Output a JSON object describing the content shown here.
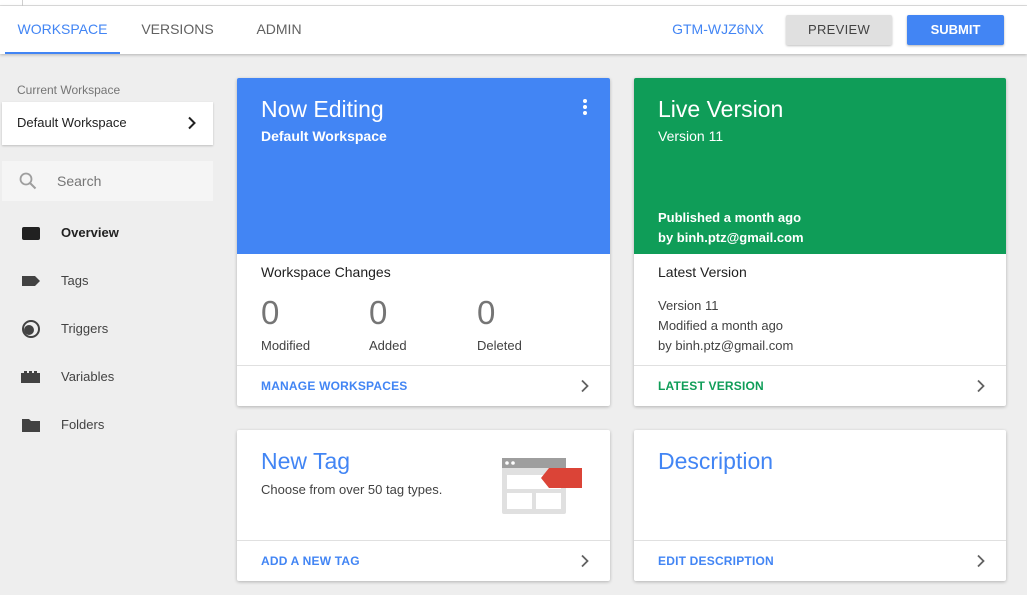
{
  "header": {
    "tabs": [
      {
        "label": "WORKSPACE",
        "active": true
      },
      {
        "label": "VERSIONS",
        "active": false
      },
      {
        "label": "ADMIN",
        "active": false
      }
    ],
    "container_id": "GTM-WJZ6NX",
    "preview_label": "PREVIEW",
    "submit_label": "SUBMIT"
  },
  "sidebar": {
    "current_workspace_label": "Current Workspace",
    "workspace_name": "Default Workspace",
    "search_placeholder": "Search",
    "items": [
      {
        "label": "Overview",
        "icon": "overview-icon",
        "active": true
      },
      {
        "label": "Tags",
        "icon": "tag-icon",
        "active": false
      },
      {
        "label": "Triggers",
        "icon": "trigger-icon",
        "active": false
      },
      {
        "label": "Variables",
        "icon": "variables-icon",
        "active": false
      },
      {
        "label": "Folders",
        "icon": "folder-icon",
        "active": false
      }
    ]
  },
  "editing_card": {
    "title": "Now Editing",
    "subtitle": "Default Workspace",
    "changes_title": "Workspace Changes",
    "stats": [
      {
        "value": "0",
        "label": "Modified"
      },
      {
        "value": "0",
        "label": "Added"
      },
      {
        "value": "0",
        "label": "Deleted"
      }
    ],
    "footer_link": "MANAGE WORKSPACES"
  },
  "live_card": {
    "title": "Live Version",
    "subtitle": "Version 11",
    "published_line1": "Published a month ago",
    "published_line2": "by binh.ptz@gmail.com",
    "latest_title": "Latest Version",
    "latest_lines": [
      "Version 11",
      "Modified a month ago",
      "by binh.ptz@gmail.com"
    ],
    "footer_link": "LATEST VERSION"
  },
  "newtag_card": {
    "title": "New Tag",
    "subtitle": "Choose from over 50 tag types.",
    "footer_link": "ADD A NEW TAG"
  },
  "description_card": {
    "title": "Description",
    "footer_link": "EDIT DESCRIPTION"
  },
  "colors": {
    "accent_blue": "#4285f4",
    "live_green": "#0f9d58",
    "tag_red": "#db4437"
  }
}
